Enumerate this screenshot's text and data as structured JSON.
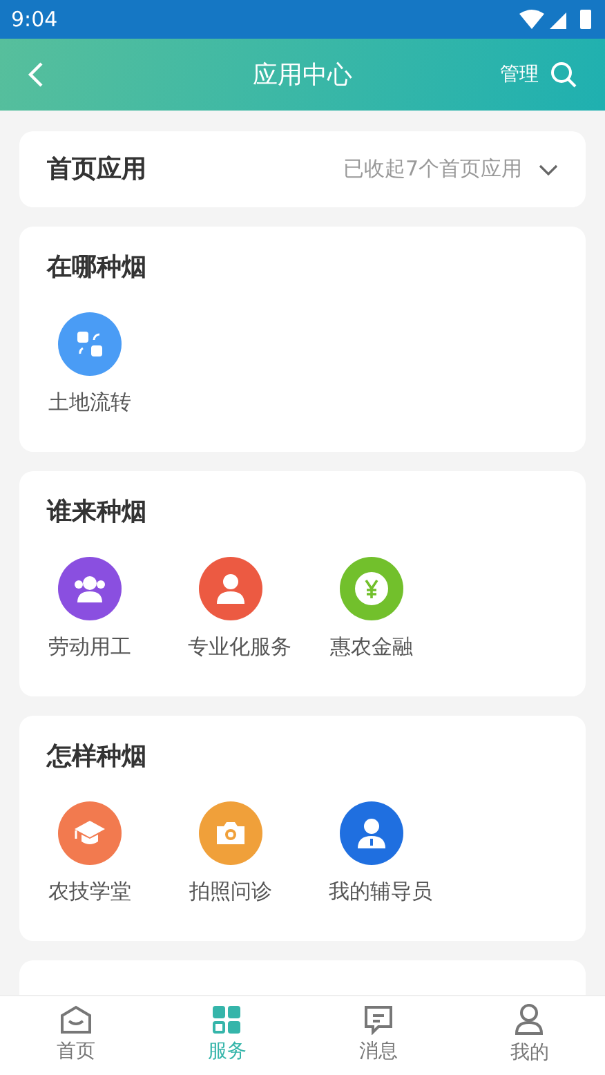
{
  "status_bar": {
    "time": "9:04"
  },
  "header": {
    "title": "应用中心",
    "action": "管理"
  },
  "home_apps": {
    "title": "首页应用",
    "summary": "已收起7个首页应用",
    "expanded": false
  },
  "sections": [
    {
      "title": "在哪种烟",
      "apps": [
        {
          "label": "土地流转",
          "color": "#4a9cf5"
        }
      ]
    },
    {
      "title": "谁来种烟",
      "apps": [
        {
          "label": "劳动用工",
          "color": "#8a4fe0"
        },
        {
          "label": "专业化服务",
          "color": "#ec5a42"
        },
        {
          "label": "惠农金融",
          "color": "#72c02c"
        }
      ]
    },
    {
      "title": "怎样种烟",
      "apps": [
        {
          "label": "农技学堂",
          "color": "#f27a4f"
        },
        {
          "label": "拍照问诊",
          "color": "#f0a03a"
        },
        {
          "label": "我的辅导员",
          "color": "#1f6fe0"
        }
      ]
    }
  ],
  "tab_bar": [
    {
      "label": "首页",
      "selected": false
    },
    {
      "label": "服务",
      "selected": true
    },
    {
      "label": "消息",
      "selected": false
    },
    {
      "label": "我的",
      "selected": false
    }
  ]
}
